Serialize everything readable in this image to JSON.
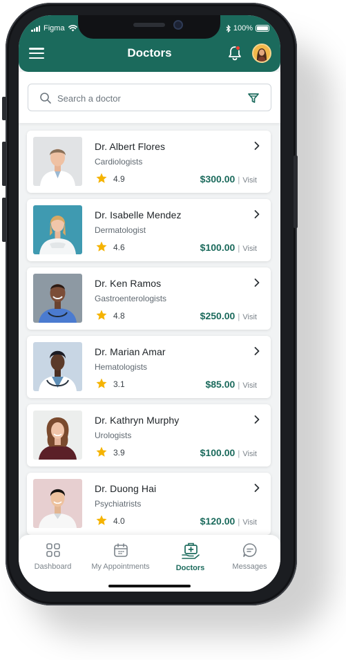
{
  "status_bar": {
    "carrier": "Figma",
    "battery": "100%"
  },
  "header": {
    "title": "Doctors",
    "menu_icon": "menu-icon",
    "notification_icon": "bell-icon",
    "has_notification": true
  },
  "search": {
    "placeholder": "Search a doctor",
    "value": "",
    "filter_icon": "filter-icon"
  },
  "doctors": [
    {
      "name": "Dr. Albert Flores",
      "specialty": "Cardiologists",
      "rating": "4.9",
      "price": "$300.00",
      "unit": "Visit"
    },
    {
      "name": "Dr. Isabelle Mendez",
      "specialty": "Dermatologist",
      "rating": "4.6",
      "price": "$100.00",
      "unit": "Visit"
    },
    {
      "name": "Dr. Ken Ramos",
      "specialty": "Gastroenterologists",
      "rating": "4.8",
      "price": "$250.00",
      "unit": "Visit"
    },
    {
      "name": "Dr. Marian Amar",
      "specialty": "Hematologists",
      "rating": "3.1",
      "price": "$85.00",
      "unit": "Visit"
    },
    {
      "name": "Dr. Kathryn Murphy",
      "specialty": "Urologists",
      "rating": "3.9",
      "price": "$100.00",
      "unit": "Visit"
    },
    {
      "name": "Dr. Duong Hai",
      "specialty": "Psychiatrists",
      "rating": "4.0",
      "price": "$120.00",
      "unit": "Visit"
    }
  ],
  "tabs": [
    {
      "label": "Dashboard",
      "icon": "grid-icon",
      "active": false
    },
    {
      "label": "My Appointments",
      "icon": "calendar-icon",
      "active": false
    },
    {
      "label": "Doctors",
      "icon": "medical-kit-icon",
      "active": true
    },
    {
      "label": "Messages",
      "icon": "chat-icon",
      "active": false
    }
  ],
  "colors": {
    "primary": "#1b6a5c",
    "star": "#f5b301",
    "badge": "#ff3b30"
  }
}
